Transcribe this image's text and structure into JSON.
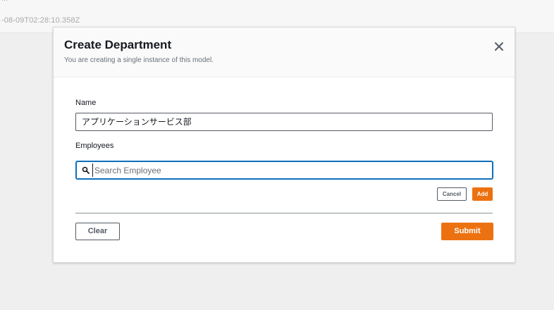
{
  "background": {
    "cut_text": "...",
    "timestamp": "-08-09T02:28:10.358Z"
  },
  "modal": {
    "title": "Create Department",
    "subtitle": "You are creating a single instance of this model.",
    "close_icon": "close-icon"
  },
  "form": {
    "name_label": "Name",
    "name_value": "アプリケーションサービス部",
    "employees_label": "Employees",
    "search_placeholder": "Search Employee",
    "search_value": "",
    "cancel_label": "Cancel",
    "add_label": "Add",
    "clear_label": "Clear",
    "submit_label": "Submit"
  },
  "colors": {
    "accent": "#ec7211",
    "focus": "#0e6fbd",
    "border": "#545b64"
  }
}
